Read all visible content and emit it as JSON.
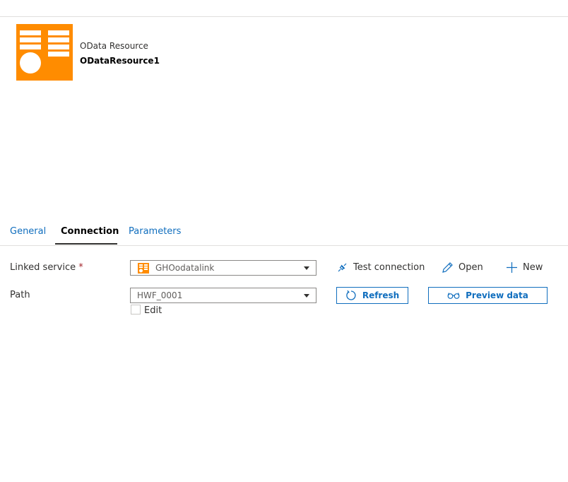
{
  "resource": {
    "type_label": "OData Resource",
    "name": "ODataResource1",
    "icon": "odata-resource-icon",
    "accent_color": "#ff8c00"
  },
  "tabs": [
    {
      "label": "General",
      "active": false
    },
    {
      "label": "Connection",
      "active": true
    },
    {
      "label": "Parameters",
      "active": false
    }
  ],
  "form": {
    "linked_service": {
      "label": "Linked service",
      "required_mark": "*",
      "value": "GHOodatalink"
    },
    "path": {
      "label": "Path",
      "value": "HWF_0001"
    },
    "edit_checkbox": {
      "label": "Edit",
      "checked": false
    }
  },
  "actions": {
    "test_connection": "Test connection",
    "open": "Open",
    "new": "New",
    "refresh": "Refresh",
    "preview_data": "Preview data"
  }
}
